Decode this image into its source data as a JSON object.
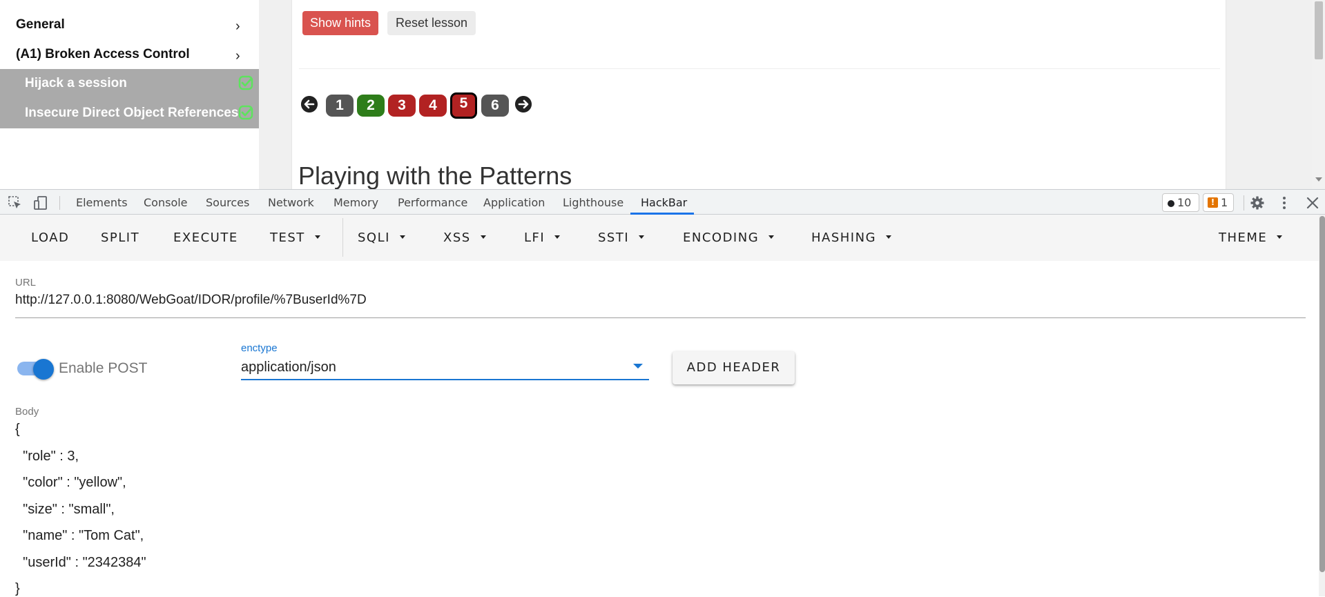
{
  "sidebar": {
    "categories": [
      {
        "label": "General"
      },
      {
        "label": "(A1) Broken Access Control"
      }
    ],
    "lessons": [
      {
        "label": "Hijack a session"
      },
      {
        "label": "Insecure Direct Object References"
      }
    ],
    "chevron": "›"
  },
  "lesson": {
    "show_hints": "Show hints",
    "reset_lesson": "Reset lesson",
    "steps": [
      "1",
      "2",
      "3",
      "4",
      "5",
      "6"
    ],
    "step_colors": [
      "#555555",
      "#2e7d1a",
      "#b22222",
      "#b22222",
      "#b22222",
      "#555555"
    ],
    "active_step": "5",
    "title": "Playing with the Patterns"
  },
  "devtools": {
    "tabs": [
      "Elements",
      "Console",
      "Sources",
      "Network",
      "Memory",
      "Performance",
      "Application",
      "Lighthouse",
      "HackBar"
    ],
    "active_tab": "HackBar",
    "error_count": "10",
    "warning_count": "1"
  },
  "hackbar": {
    "toolbar": {
      "load": "LOAD",
      "split": "SPLIT",
      "execute": "EXECUTE",
      "test": "TEST",
      "sqli": "SQLI",
      "xss": "XSS",
      "lfi": "LFI",
      "ssti": "SSTI",
      "encoding": "ENCODING",
      "hashing": "HASHING",
      "theme": "THEME"
    },
    "url_label": "URL",
    "url_value": "http://127.0.0.1:8080/WebGoat/IDOR/profile/%7BuserId%7D",
    "enable_post_label": "Enable POST",
    "enable_post_on": true,
    "enctype_label": "enctype",
    "enctype_value": "application/json",
    "add_header": "ADD HEADER",
    "body_label": "Body",
    "body_lines": [
      "{",
      "  \"role\" : 3,",
      "  \"color\" : \"yellow\",",
      "  \"size\" : \"small\",",
      "  \"name\" : \"Tom Cat\",",
      "  \"userId\" : \"2342384\"",
      "}"
    ]
  },
  "colors": {
    "hints_button": "#d9534f",
    "sidebar_selected": "#aaaaaa",
    "check_icon": "#5ee35e",
    "accent": "#1976d2",
    "devtools_tab_underline": "#1a73e8"
  }
}
